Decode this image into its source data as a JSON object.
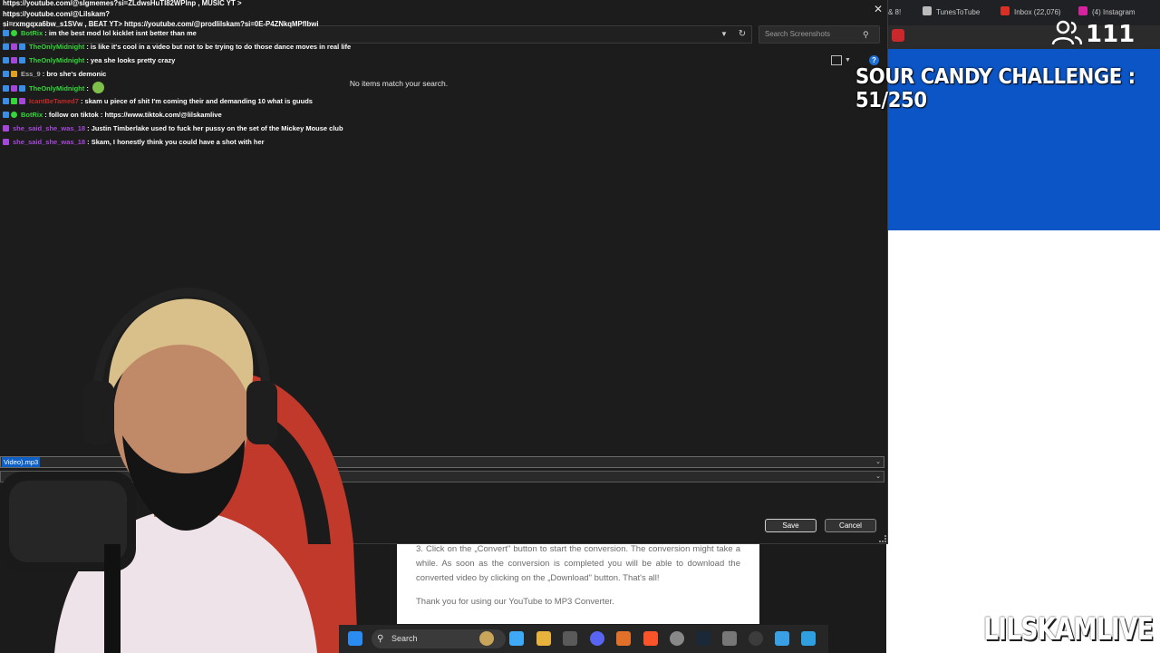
{
  "browser": {
    "tabs": [
      "& 8!",
      "TunesToTube",
      "Inbox (22,076)",
      "(4) Instagram"
    ],
    "colors": {
      "banner": "#0b55c7",
      "tabstrip": "#202124"
    }
  },
  "article": {
    "paragraph1": "3. Click on the „Convert\" button to start the conversion. The conversion might take a while. As soon as the conversion is completed you will be able to download the converted video by clicking on the „Download\" button. That's all!",
    "paragraph2": "Thank you for using our YouTube to MP3 Converter."
  },
  "dialog": {
    "close_glyph": "✕",
    "search_placeholder": "Search Screenshots",
    "empty_message": "No items match your search.",
    "filename_value": "Video).mp3",
    "save_label": "Save",
    "cancel_label": "Cancel",
    "help_glyph": "?"
  },
  "chat": {
    "links": [
      "https://youtube.com/@slgmemes?si=ZLdwsHuTl82WPlnp , MUSIC YT > https://youtube.com/@Lilskam?",
      "si=rxmgqxa6bw_s1SVw , BEAT YT> https://youtube.com/@prodlilskam?si=0E-P4ZNkqMPflbwi"
    ],
    "messages": [
      {
        "user": "BotRix",
        "color": "#35d63a",
        "text": " : im the best mod lol kicklet isnt better than me"
      },
      {
        "user": "TheOnlyMidnight",
        "color": "#35d63a",
        "text": " : is like it's cool in a video but not to be trying to do those dance moves in real life"
      },
      {
        "user": "TheOnlyMidnight",
        "color": "#35d63a",
        "text": " : yea she looks pretty crazy"
      },
      {
        "user": "Ess_9",
        "color": "#b0b0b0",
        "text": " : bro she's demonic"
      },
      {
        "user": "TheOnlyMidnight",
        "color": "#35d63a",
        "text": " : "
      },
      {
        "user": "IcantBeTamed7",
        "color": "#c22a2a",
        "text": " : skam u piece of shit I'm coming their and demanding 10 what is guuds"
      },
      {
        "user": "BotRix",
        "color": "#35d63a",
        "text": " : follow on tiktok : https://www.tiktok.com/@lilskamlive"
      },
      {
        "user": "she_said_she_was_18",
        "color": "#a548d9",
        "text": " : Justin Timberlake used to fuck her pussy on the set of the Mickey Mouse club"
      },
      {
        "user": "she_said_she_was_18",
        "color": "#a548d9",
        "text": " : Skam, I honestly think you could have a shot with her"
      }
    ]
  },
  "overlay": {
    "viewer_count": "111",
    "challenge": "SOUR CANDY CHALLENGE : 51/250",
    "brand": "LILSKAMLIVE"
  },
  "taskbar": {
    "search_label": "Search"
  }
}
